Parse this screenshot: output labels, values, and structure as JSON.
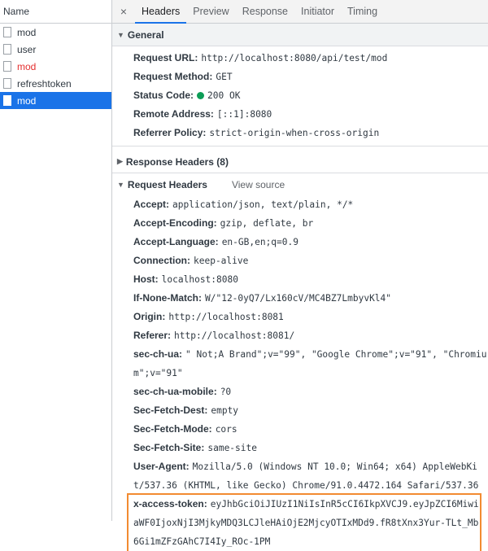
{
  "left": {
    "header": "Name",
    "requests": [
      {
        "name": "mod",
        "state": "normal"
      },
      {
        "name": "user",
        "state": "normal"
      },
      {
        "name": "mod",
        "state": "error"
      },
      {
        "name": "refreshtoken",
        "state": "normal"
      },
      {
        "name": "mod",
        "state": "selected"
      }
    ]
  },
  "tabs": {
    "close": "×",
    "items": [
      "Headers",
      "Preview",
      "Response",
      "Initiator",
      "Timing"
    ],
    "active": "Headers"
  },
  "general": {
    "title": "General",
    "rows": [
      {
        "k": "Request URL:",
        "v": "http://localhost:8080/api/test/mod"
      },
      {
        "k": "Request Method:",
        "v": "GET"
      },
      {
        "k": "Status Code:",
        "v": "200 OK"
      },
      {
        "k": "Remote Address:",
        "v": "[::1]:8080"
      },
      {
        "k": "Referrer Policy:",
        "v": "strict-origin-when-cross-origin"
      }
    ],
    "status_color": "#0d9d57"
  },
  "response_headers": {
    "title": "Response Headers (8)"
  },
  "request_headers": {
    "title": "Request Headers",
    "view_source": "View source",
    "rows": [
      {
        "k": "Accept:",
        "v": "application/json, text/plain, */*"
      },
      {
        "k": "Accept-Encoding:",
        "v": "gzip, deflate, br"
      },
      {
        "k": "Accept-Language:",
        "v": "en-GB,en;q=0.9"
      },
      {
        "k": "Connection:",
        "v": "keep-alive"
      },
      {
        "k": "Host:",
        "v": "localhost:8080"
      },
      {
        "k": "If-None-Match:",
        "v": "W/\"12-0yQ7/Lx160cV/MC4BZ7LmbyvKl4\""
      },
      {
        "k": "Origin:",
        "v": "http://localhost:8081"
      },
      {
        "k": "Referer:",
        "v": "http://localhost:8081/"
      },
      {
        "k": "sec-ch-ua:",
        "v": "\" Not;A Brand\";v=\"99\", \"Google Chrome\";v=\"91\", \"Chromium\";v=\"91\""
      },
      {
        "k": "sec-ch-ua-mobile:",
        "v": "?0"
      },
      {
        "k": "Sec-Fetch-Dest:",
        "v": "empty"
      },
      {
        "k": "Sec-Fetch-Mode:",
        "v": "cors"
      },
      {
        "k": "Sec-Fetch-Site:",
        "v": "same-site"
      },
      {
        "k": "User-Agent:",
        "v": "Mozilla/5.0 (Windows NT 10.0; Win64; x64) AppleWebKit/537.36 (KHTML, like Gecko) Chrome/91.0.4472.164 Safari/537.36"
      },
      {
        "k": "x-access-token:",
        "v": "eyJhbGciOiJIUzI1NiIsInR5cCI6IkpXVCJ9.eyJpZCI6MiwiaWF0IjoxNjI3MjkyMDQ3LCJleHAiOjE2MjcyOTIxMDd9.fR8tXnx3Yur-TLt_Mb6Gi1mZFzGAhC7I4Iy_ROc-1PM"
      }
    ],
    "highlight_color": "#f28b31"
  }
}
